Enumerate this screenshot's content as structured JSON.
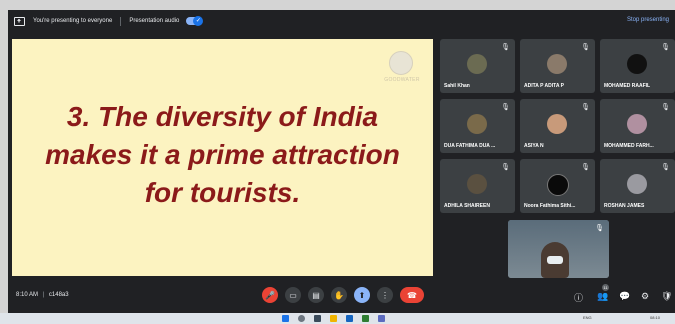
{
  "topbar": {
    "presenting_text": "You're presenting to everyone",
    "audio_label": "Presentation audio",
    "stop_label": "Stop presenting"
  },
  "slide": {
    "line1": "3. The diversity of India",
    "line2": "makes it a prime attraction",
    "line3": "for tourists.",
    "logo_text": "GOODWATER"
  },
  "participants": [
    {
      "name": "Sahil Khan"
    },
    {
      "name": "ADITA P ADITA P"
    },
    {
      "name": "MOHAMED RAAFIL"
    },
    {
      "name": "DUA FATHIMA DUA ..."
    },
    {
      "name": "ASIYA N"
    },
    {
      "name": "MOHAMMED FARH..."
    },
    {
      "name": "ADHILA SHAIREEN"
    },
    {
      "name": "Noora Fathima Sithi..."
    },
    {
      "name": "ROSHAN JAMES"
    }
  ],
  "bottombar": {
    "time": "8:10 AM",
    "separator": "|",
    "meeting_code": "c148a3",
    "people_count": "11"
  },
  "taskbar": {
    "lang": "ENG",
    "clock": "08:10"
  }
}
